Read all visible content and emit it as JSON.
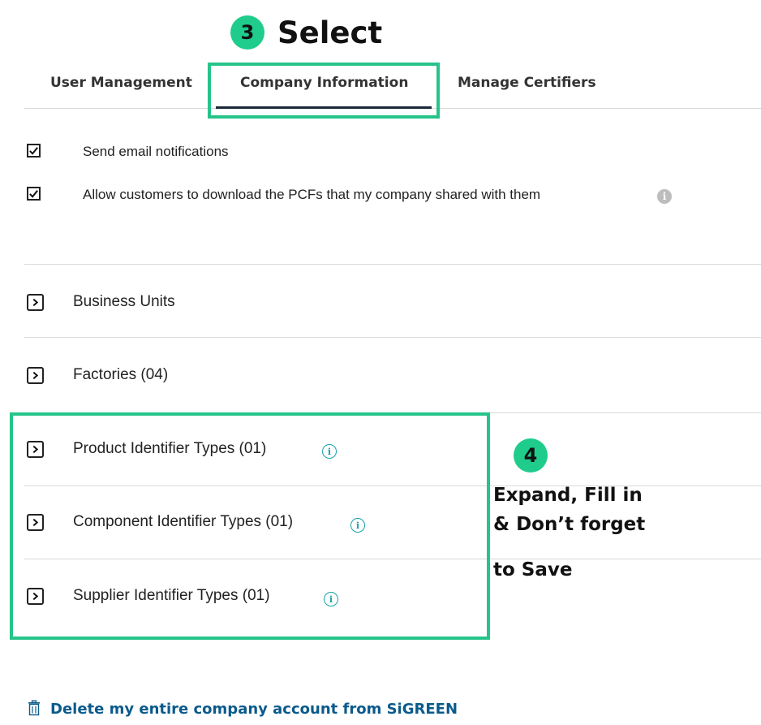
{
  "annotations": {
    "step3": {
      "number": "3",
      "title": "Select"
    },
    "step4": {
      "number": "4",
      "title_lines": [
        "Expand, Fill in",
        "& Don’t forget",
        "to Save"
      ]
    }
  },
  "tabs": [
    {
      "label": "User Management",
      "active": false
    },
    {
      "label": "Company Information",
      "active": true
    },
    {
      "label": "Manage Certifiers",
      "active": false
    }
  ],
  "settings": [
    {
      "label": "Send email notifications",
      "checked": true
    },
    {
      "label": "Allow customers to download the PCFs that my company shared with them",
      "checked": true,
      "info_icon": "info-icon"
    }
  ],
  "sections": [
    {
      "label": "Business Units",
      "info": false
    },
    {
      "label": "Factories (04)",
      "info": false
    },
    {
      "label": "Product Identifier Types (01)",
      "info": true
    },
    {
      "label": "Component Identifier Types (01)",
      "info": true
    },
    {
      "label": "Supplier Identifier Types (01)",
      "info": true
    }
  ],
  "delete_link": {
    "label": "Delete my entire company account from SiGREEN",
    "icon": "trash-icon"
  },
  "colors": {
    "accent_green": "#27c48a",
    "badge_green": "#1fcc8c",
    "link_blue": "#0a5a8c",
    "info_teal": "#17a2a8",
    "tab_underline": "#1a2a3a"
  }
}
